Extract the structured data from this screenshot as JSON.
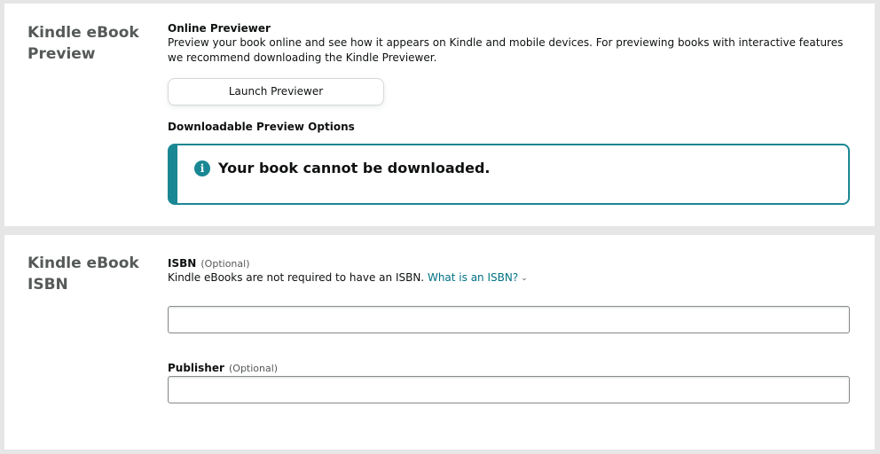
{
  "preview": {
    "title": "Kindle eBook Preview",
    "online_heading": "Online Previewer",
    "online_desc": "Preview your book online and see how it appears on Kindle and mobile devices. For previewing books with interactive features we recommend downloading the Kindle Previewer.",
    "launch_button": "Launch Previewer",
    "download_heading": "Downloadable Preview Options",
    "alert_icon": "info-icon",
    "alert_text": "Your book cannot be downloaded."
  },
  "isbn": {
    "title": "Kindle eBook ISBN",
    "isbn_label": "ISBN",
    "isbn_optional": "(Optional)",
    "isbn_help": "Kindle eBooks are not required to have an ISBN.",
    "isbn_link": "What is an ISBN?",
    "isbn_value": "",
    "publisher_label": "Publisher",
    "publisher_optional": "(Optional)",
    "publisher_value": ""
  },
  "colors": {
    "accent": "#1a8794",
    "link": "#007185",
    "page_bg": "#e6e6e6"
  }
}
